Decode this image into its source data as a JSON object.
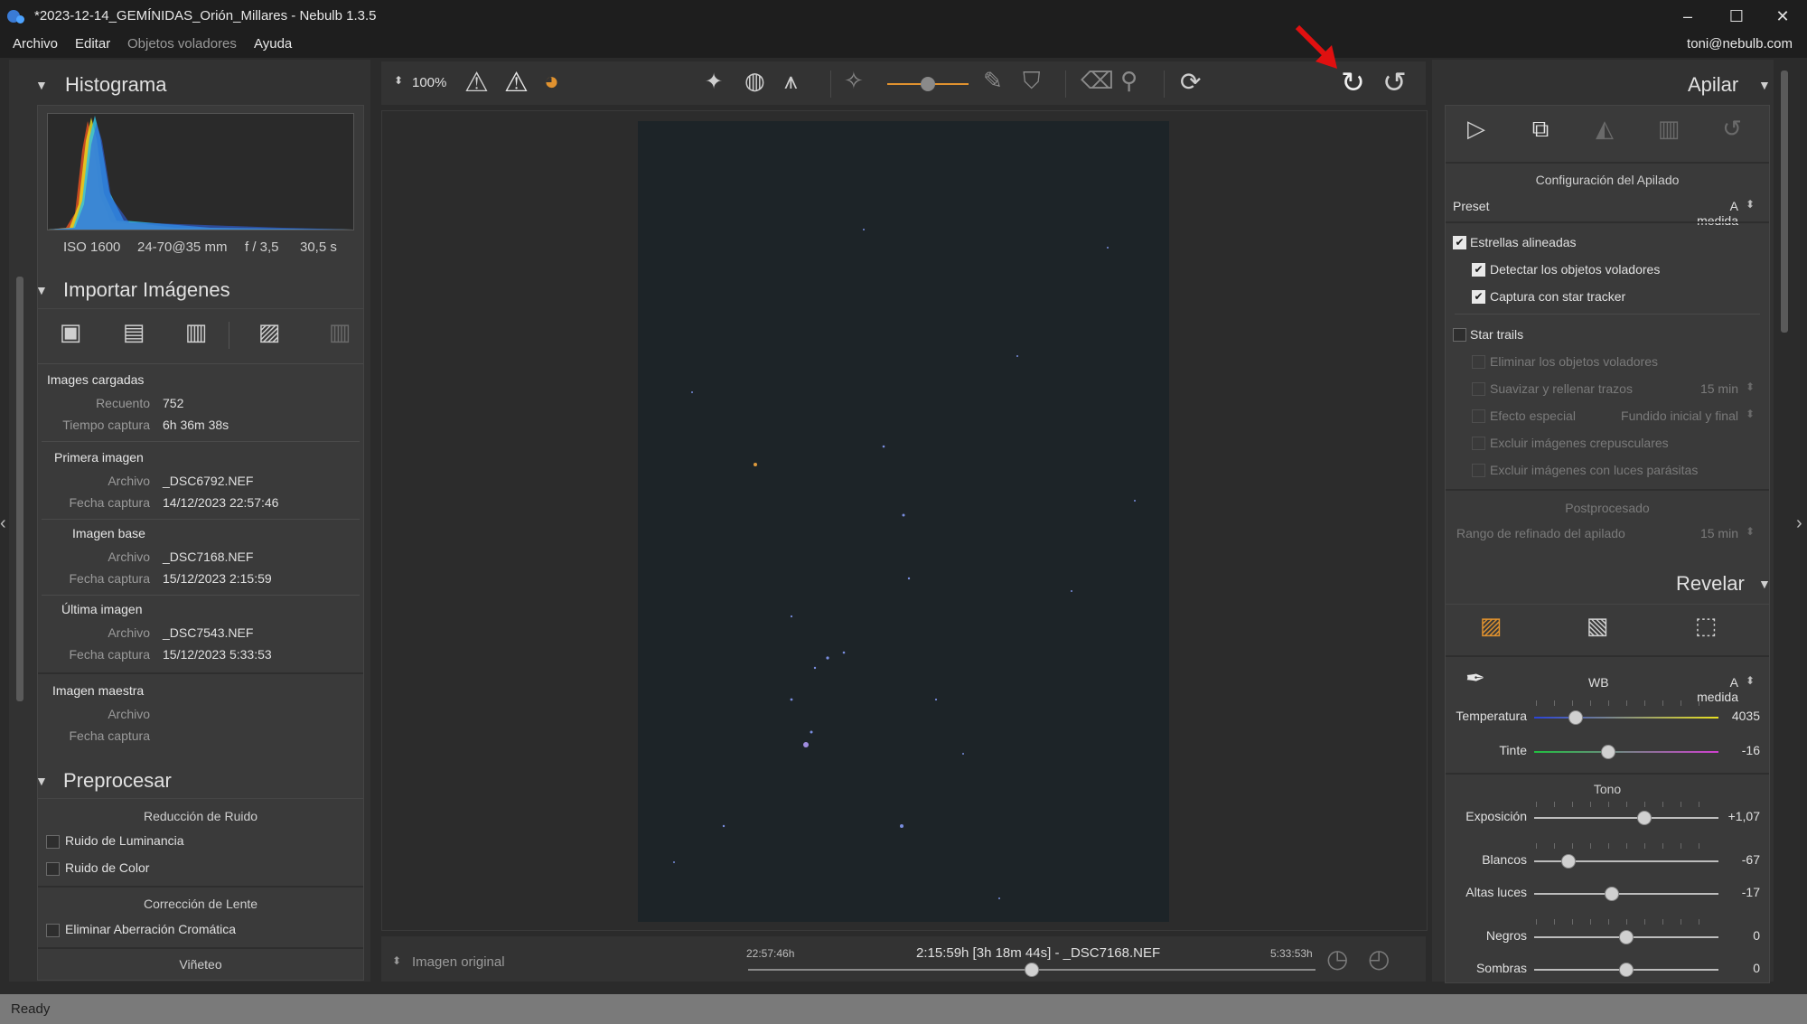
{
  "window": {
    "title": "*2023-12-14_GEMÍNIDAS_Orión_Millares - Nebulb 1.3.5"
  },
  "menu": {
    "items": [
      "Archivo",
      "Editar",
      "Objetos voladores",
      "Ayuda"
    ],
    "user": "toni@nebulb.com"
  },
  "left": {
    "histogram": {
      "title": "Histograma",
      "meta": [
        "ISO 1600",
        "24-70@35 mm",
        "f / 3,5",
        "30,5 s"
      ]
    },
    "import": {
      "title": "Importar Imágenes",
      "loaded_title": "Images cargadas",
      "count_label": "Recuento",
      "count_value": "752",
      "time_label": "Tiempo captura",
      "time_value": "6h 36m 38s",
      "first_title": "Primera imagen",
      "file_label": "Archivo",
      "date_label": "Fecha captura",
      "first_file": "_DSC6792.NEF",
      "first_date": "14/12/2023 22:57:46",
      "base_title": "Imagen base",
      "base_file": "_DSC7168.NEF",
      "base_date": "15/12/2023 2:15:59",
      "last_title": "Última imagen",
      "last_file": "_DSC7543.NEF",
      "last_date": "15/12/2023 5:33:53",
      "master_title": "Imagen maestra"
    },
    "preprocess": {
      "title": "Preprocesar",
      "noise_title": "Reducción de Ruido",
      "noise_lum": "Ruido de Luminancia",
      "noise_color": "Ruido de Color",
      "lens_title": "Corrección de Lente",
      "chromatic": "Eliminar Aberración Cromática",
      "vignette": "Viñeteo"
    }
  },
  "toolbar": {
    "zoom": "100%"
  },
  "timeline": {
    "mode": "Imagen original",
    "start": "22:57:46h",
    "current": "2:15:59h [3h 18m 44s] - _DSC7168.NEF",
    "end": "5:33:53h",
    "position": 0.5
  },
  "right": {
    "stack": {
      "title": "Apilar",
      "config_title": "Configuración del Apilado",
      "preset_label": "Preset",
      "preset_value": "A medida",
      "aligned": "Estrellas alineadas",
      "detect": "Detectar los objetos voladores",
      "tracker": "Captura con star tracker",
      "trails": "Star trails",
      "remove": "Eliminar los objetos voladores",
      "smooth": "Suavizar y rellenar trazos",
      "smooth_val": "15 min",
      "effect": "Efecto especial",
      "effect_val": "Fundido inicial y final",
      "twilight": "Excluir imágenes crepusculares",
      "parasite": "Excluir imágenes con luces parásitas",
      "post_title": "Postprocesado",
      "refine": "Rango de refinado del apilado",
      "refine_val": "15 min"
    },
    "develop": {
      "title": "Revelar",
      "wb_label": "WB",
      "wb_value": "A medida",
      "temp_label": "Temperatura",
      "temp_value": "4035",
      "tint_label": "Tinte",
      "tint_value": "-16",
      "tone_title": "Tono",
      "exp_label": "Exposición",
      "exp_value": "+1,07",
      "whites_label": "Blancos",
      "whites_value": "-67",
      "high_label": "Altas luces",
      "high_value": "-17",
      "blacks_label": "Negros",
      "blacks_value": "0",
      "shadows_label": "Sombras",
      "shadows_value": "0"
    }
  },
  "status": {
    "text": "Ready"
  },
  "colors": {
    "accent": "#e0922f",
    "annotation_arrow": "#e01010"
  }
}
